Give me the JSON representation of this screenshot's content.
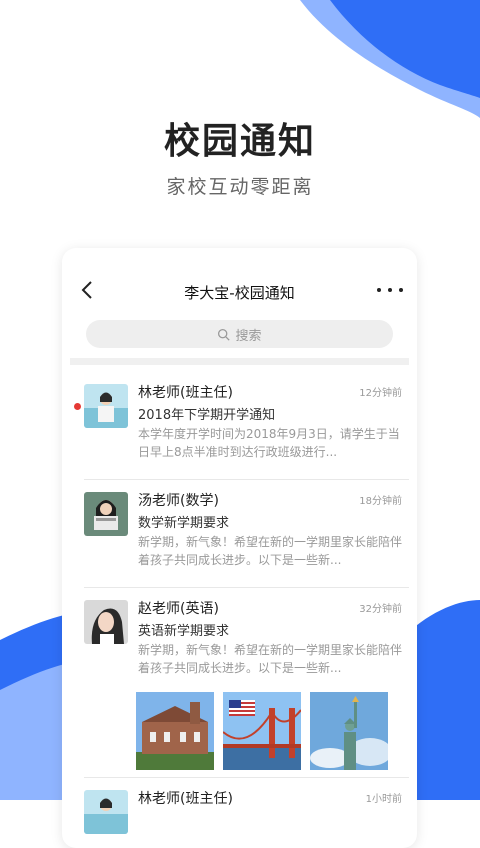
{
  "hero": {
    "title": "校园通知",
    "subtitle": "家校互动零距离"
  },
  "colors": {
    "accent": "#2f6ef6",
    "unread": "#e53935"
  },
  "topbar": {
    "title": "李大宝-校园通知",
    "back_icon": "chevron-left-icon",
    "more_icon": "more-horizontal-icon"
  },
  "search": {
    "placeholder": "搜索"
  },
  "notifications": [
    {
      "name": "林老师(班主任)",
      "time": "12分钟前",
      "subject": "2018年下学期开学通知",
      "preview": "本学年度开学时间为2018年9月3日，请学生于当日早上8点半准时到达行政班级进行...",
      "unread": true
    },
    {
      "name": "汤老师(数学)",
      "time": "18分钟前",
      "subject": "数学新学期要求",
      "preview": "新学期，新气象！希望在新的一学期里家长能陪伴着孩子共同成长进步。以下是一些新...",
      "unread": false
    },
    {
      "name": "赵老师(英语)",
      "time": "32分钟前",
      "subject": "英语新学期要求",
      "preview": "新学期，新气象！希望在新的一学期里家长能陪伴着孩子共同成长进步。以下是一些新...",
      "unread": false,
      "photos": [
        "campus-building-photo",
        "golden-gate-bridge-photo",
        "statue-of-liberty-photo"
      ]
    },
    {
      "name": "林老师(班主任)",
      "time": "1小时前",
      "subject": "",
      "preview": "",
      "unread": false
    }
  ]
}
